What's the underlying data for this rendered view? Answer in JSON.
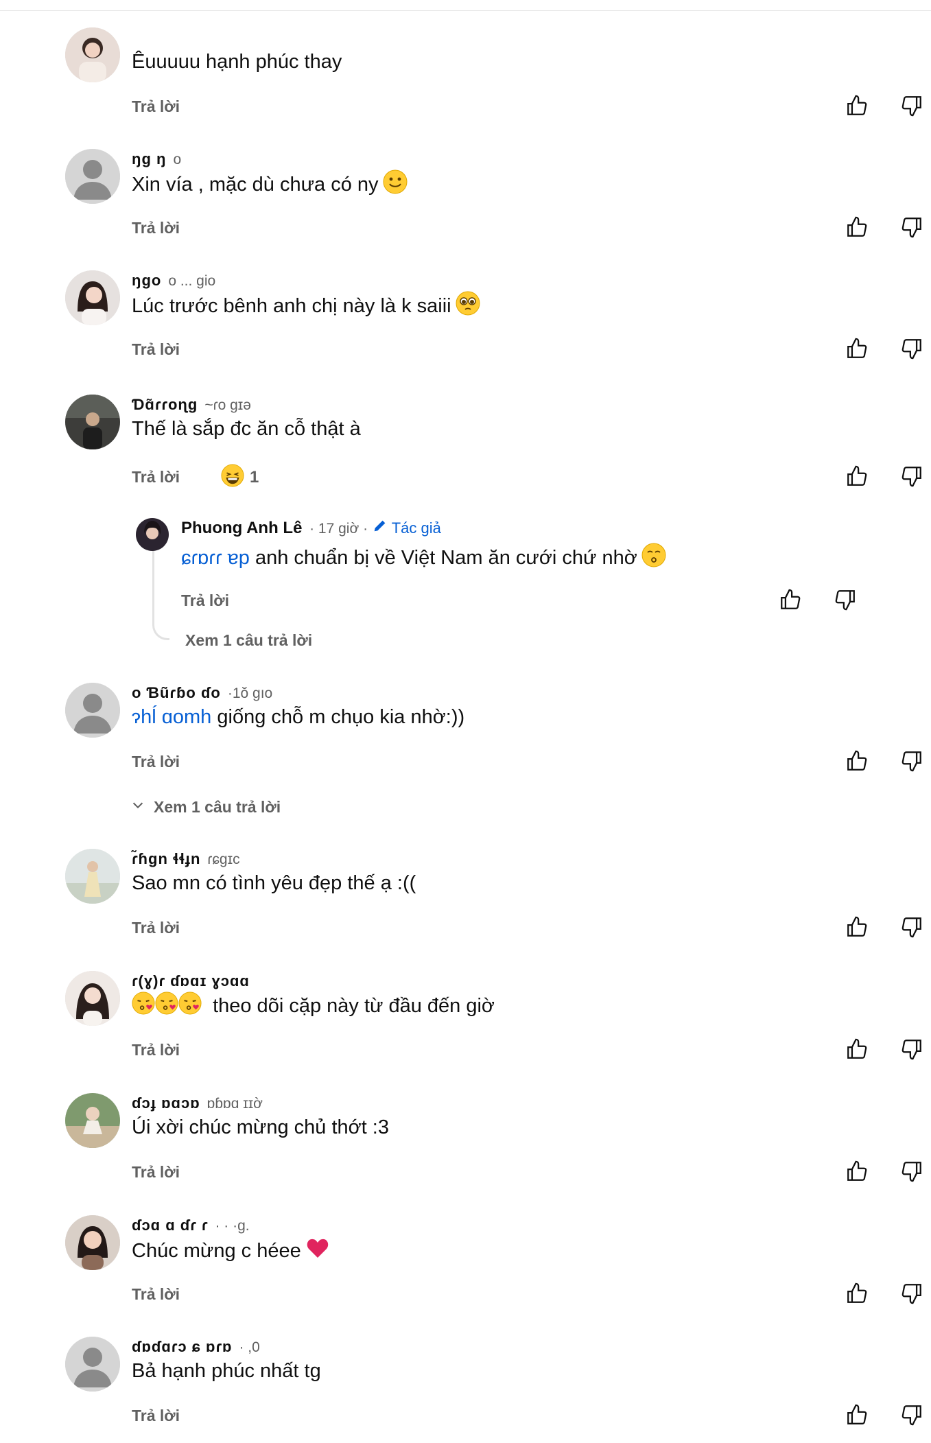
{
  "reply_label": "Trả lời",
  "colors": {
    "link": "#065fd4",
    "secondary": "#606060"
  },
  "comments": [
    {
      "author": "",
      "time": "",
      "text": "Êuuuuu hạnh phúc thay",
      "avatar": "photo"
    },
    {
      "author": "ŋɡ ŋ",
      "time": "o",
      "text": "Xin vía , mặc dù chưa có ny",
      "emoji": "slight-smile",
      "avatar": "default"
    },
    {
      "author": "ŋgo",
      "time": "o  ... gio",
      "text": "Lúc trước bênh anh chị này là k saiii",
      "emoji": "pleading",
      "avatar": "photo"
    },
    {
      "author": "Ɗɑ̃ɾɾoɳɡ",
      "time": "~ɾo gɪə",
      "text": "Thế là sắp đc ăn cỗ thật à",
      "reaction_count": "1",
      "avatar": "photo"
    },
    {
      "author": "o Ɓũɾɓo ɗo",
      "time": "·1ŏ gıo",
      "mention": "ɂhĺ ɑomh",
      "text": " giống chỗ m chụo kia nhờ:))",
      "avatar": "default",
      "view_more": "Xem 1 câu trả lời"
    },
    {
      "author": "ɾ̃ɦɡn ɬɬɟn",
      "time": "ɾɕɡɪc",
      "text": "Sao mn có tình yêu đẹp thế ạ :((",
      "avatar": "photo"
    },
    {
      "author": "ɾ(ɣ)ɾ ɗɒɑɪ ɣɔɑɑ",
      "time": "",
      "text": "theo dõi cặp này từ đầu đến giờ",
      "emoji_prefix": "kiss-heart",
      "avatar": "photo"
    },
    {
      "author": "ɗɔɟ ɒɑɔɒ",
      "time": "ɒɓɒɑ  ɪɪờ",
      "text": "Úi xời chúc mừng chủ thớt :3",
      "avatar": "photo"
    },
    {
      "author": "ɗɔɑ  ɑ ɗɾ ɾ",
      "time": "· · ·g.",
      "text": "Chúc mừng c héee",
      "emoji": "red-heart",
      "avatar": "photo"
    },
    {
      "author": "ɗɒɗɑɾɔ ɕ ɒɾɒ",
      "time": "· ,0",
      "text": "Bả hạnh phúc nhất tg",
      "avatar": "default"
    }
  ],
  "reply": {
    "author": "Phuong Anh Lê",
    "time": "· 17 giờ ·",
    "badge": "Tác giả",
    "mention": "ɕɾɒɾɾ ɐp",
    "text": " anh chuẩn bị về Việt Nam ăn cưới chứ nhờ",
    "emoji": "kissing",
    "view_more": "Xem 1 câu trả lời"
  }
}
